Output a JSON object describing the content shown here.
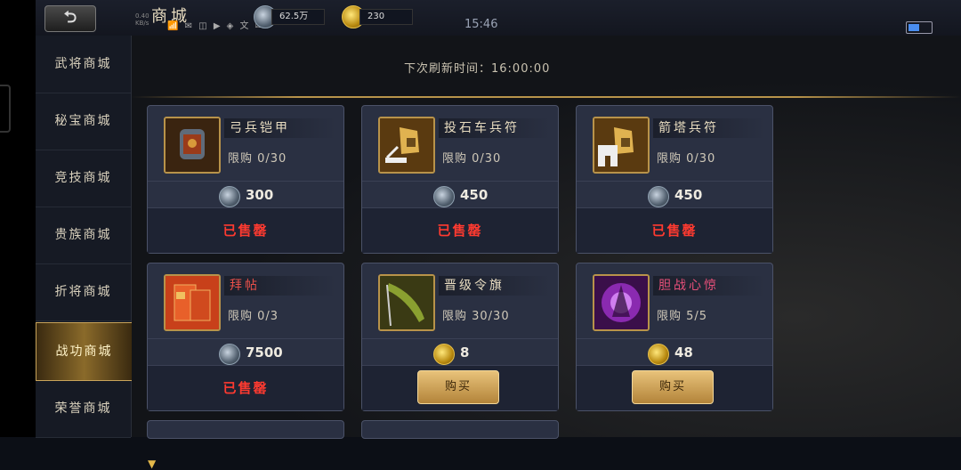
{
  "top_bar": {
    "back_label": "⮌",
    "title": "商城",
    "status_small": "0.40\nKB/s",
    "status_icons": "📶 ✉ ◫ ▶ ◈ 文 ✉",
    "silver_value": "62.5万",
    "gold_value": "230",
    "clock": "15:46"
  },
  "sidebar": {
    "items": [
      {
        "label": "武将商城"
      },
      {
        "label": "秘宝商城"
      },
      {
        "label": "竞技商城"
      },
      {
        "label": "贵族商城"
      },
      {
        "label": "折将商城"
      },
      {
        "label": "战功商城",
        "active": true
      },
      {
        "label": "荣誉商城"
      }
    ]
  },
  "shop": {
    "refresh_text": "下次刷新时间：16:00:00",
    "cards": [
      {
        "name": "弓兵铠甲",
        "limit": "限购  0/30",
        "price": "300",
        "currency": "silver",
        "status": "已售罄"
      },
      {
        "name": "投石车兵符",
        "limit": "限购  0/30",
        "price": "450",
        "currency": "silver",
        "status": "已售罄"
      },
      {
        "name": "箭塔兵符",
        "limit": "限购  0/30",
        "price": "450",
        "currency": "silver",
        "status": "已售罄"
      },
      {
        "name": "拜帖",
        "limit": "限购  0/3",
        "price": "7500",
        "currency": "silver",
        "status": "已售罄"
      },
      {
        "name": "晋级令旗",
        "limit": "限购   30/30",
        "price": "8",
        "currency": "gold",
        "button": "购买"
      },
      {
        "name": "胆战心惊",
        "limit": "限购   5/5",
        "price": "48",
        "currency": "gold",
        "button": "购买"
      }
    ]
  },
  "colors": {
    "accent_gold": "#b8934a",
    "soldout_red": "#ff3a30",
    "panel": "#2a3042"
  }
}
